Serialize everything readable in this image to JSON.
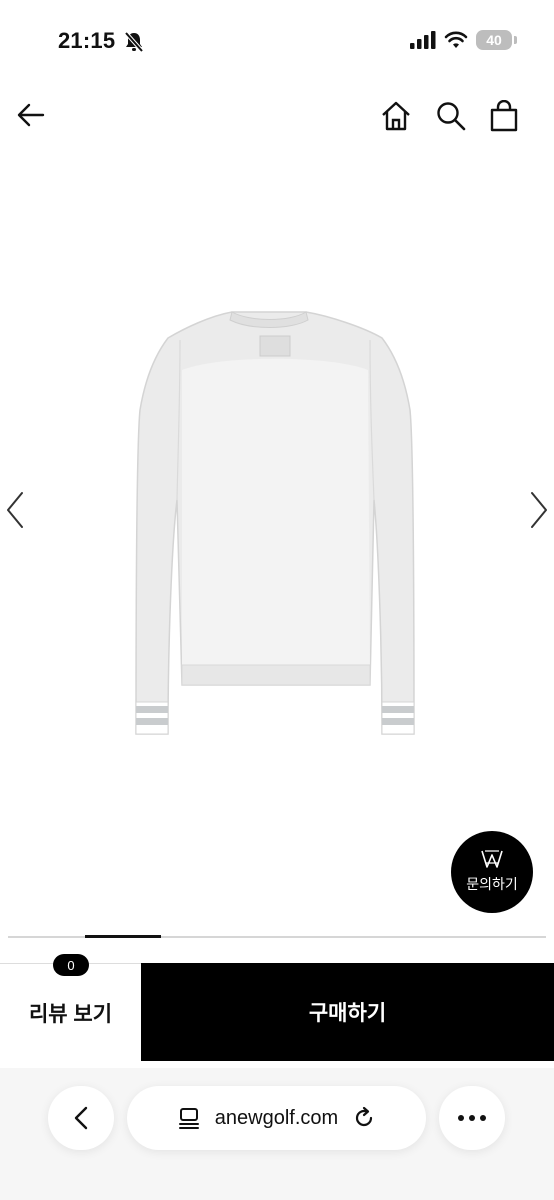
{
  "status_bar": {
    "time": "21:15",
    "battery": "40"
  },
  "product": {
    "inquiry_label": "문의하기",
    "image_progress": 0.14
  },
  "actions": {
    "review_count": "0",
    "review_label": "리뷰 보기",
    "buy_label": "구매하기"
  },
  "browser": {
    "url": "anewgolf.com"
  },
  "colors": {
    "primary": "#000000",
    "background": "#ffffff",
    "sleeve_stripe": "#c9ccce"
  }
}
